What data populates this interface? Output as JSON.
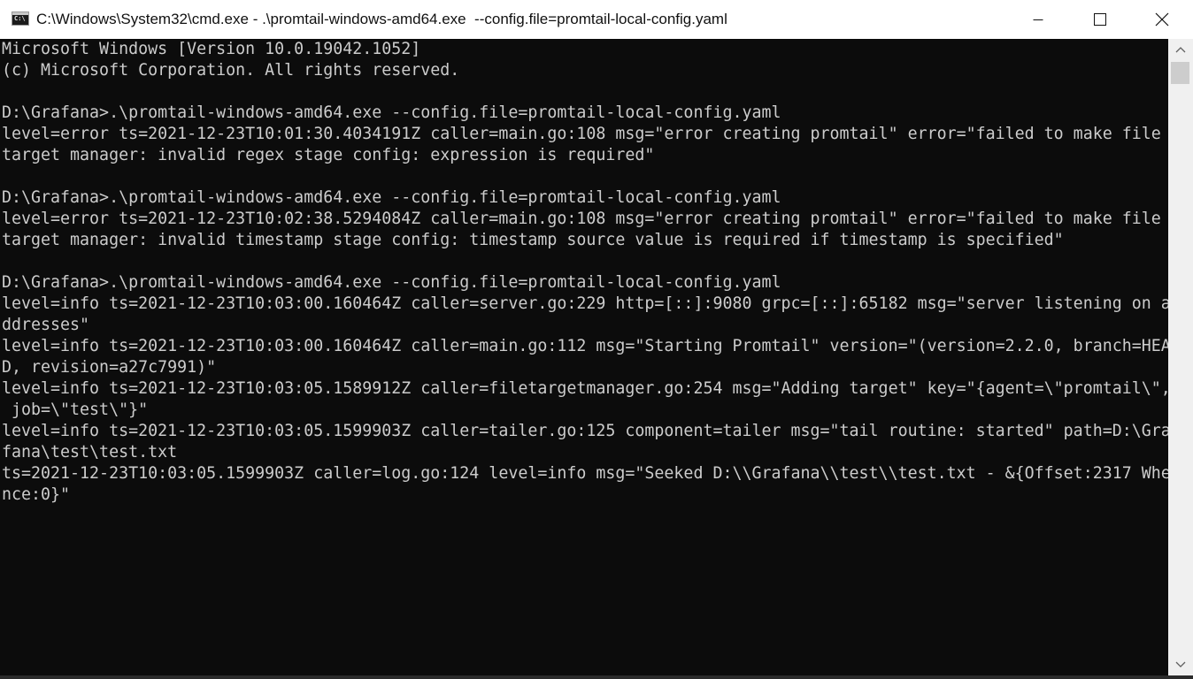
{
  "window": {
    "title": "C:\\Windows\\System32\\cmd.exe - .\\promtail-windows-amd64.exe  --config.file=promtail-local-config.yaml",
    "app_icon_text": "C:\\",
    "controls": {
      "minimize_icon": "minimize-icon",
      "maximize_icon": "maximize-icon",
      "close_icon": "close-icon"
    }
  },
  "console": {
    "background": "#0c0c0c",
    "foreground": "#cccccc",
    "lines": [
      "Microsoft Windows [Version 10.0.19042.1052]",
      "(c) Microsoft Corporation. All rights reserved.",
      "",
      "D:\\Grafana>.\\promtail-windows-amd64.exe --config.file=promtail-local-config.yaml",
      "level=error ts=2021-12-23T10:01:30.4034191Z caller=main.go:108 msg=\"error creating promtail\" error=\"failed to make file",
      "target manager: invalid regex stage config: expression is required\"",
      "",
      "D:\\Grafana>.\\promtail-windows-amd64.exe --config.file=promtail-local-config.yaml",
      "level=error ts=2021-12-23T10:02:38.5294084Z caller=main.go:108 msg=\"error creating promtail\" error=\"failed to make file",
      "target manager: invalid timestamp stage config: timestamp source value is required if timestamp is specified\"",
      "",
      "D:\\Grafana>.\\promtail-windows-amd64.exe --config.file=promtail-local-config.yaml",
      "level=info ts=2021-12-23T10:03:00.160464Z caller=server.go:229 http=[::]:9080 grpc=[::]:65182 msg=\"server listening on a",
      "ddresses\"",
      "level=info ts=2021-12-23T10:03:00.160464Z caller=main.go:112 msg=\"Starting Promtail\" version=\"(version=2.2.0, branch=HEA",
      "D, revision=a27c7991)\"",
      "level=info ts=2021-12-23T10:03:05.1589912Z caller=filetargetmanager.go:254 msg=\"Adding target\" key=\"{agent=\\\"promtail\\\",",
      " job=\\\"test\\\"}\"",
      "level=info ts=2021-12-23T10:03:05.1599903Z caller=tailer.go:125 component=tailer msg=\"tail routine: started\" path=D:\\Gra",
      "fana\\test\\test.txt",
      "ts=2021-12-23T10:03:05.1599903Z caller=log.go:124 level=info msg=\"Seeked D:\\\\Grafana\\\\test\\\\test.txt - &{Offset:2317 Whe",
      "nce:0}\""
    ]
  },
  "scrollbar": {
    "up_icon": "scroll-up-arrow-icon",
    "down_icon": "scroll-down-arrow-icon",
    "color": "#f0f0f0"
  }
}
